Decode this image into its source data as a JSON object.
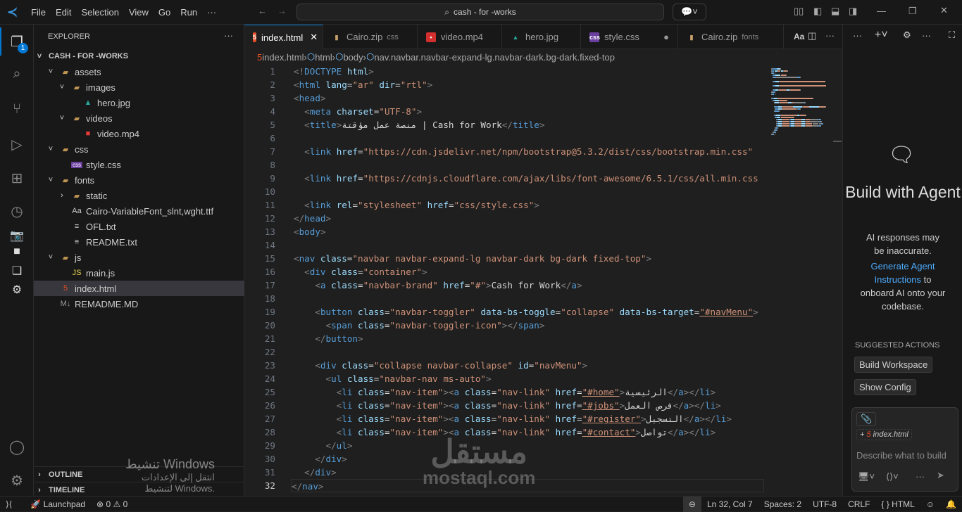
{
  "titlebar": {
    "menu": [
      "File",
      "Edit",
      "Selection",
      "View",
      "Go",
      "Run",
      "···"
    ],
    "search": "cash - for -works"
  },
  "activity": {
    "badge": "1"
  },
  "sidebar": {
    "title": "EXPLORER",
    "more": "···",
    "root": "CASH - FOR -WORKS",
    "items": [
      {
        "label": "assets",
        "level": 1,
        "kind": "folder",
        "open": true
      },
      {
        "label": "images",
        "level": 2,
        "kind": "folder",
        "open": true
      },
      {
        "label": "hero.jpg",
        "level": 3,
        "kind": "image"
      },
      {
        "label": "videos",
        "level": 2,
        "kind": "folder",
        "open": true
      },
      {
        "label": "video.mp4",
        "level": 3,
        "kind": "video"
      },
      {
        "label": "css",
        "level": 1,
        "kind": "folder",
        "open": true
      },
      {
        "label": "style.css",
        "level": 2,
        "kind": "css"
      },
      {
        "label": "fonts",
        "level": 1,
        "kind": "folder",
        "open": true
      },
      {
        "label": "static",
        "level": 2,
        "kind": "folder",
        "open": false
      },
      {
        "label": "Cairo-VariableFont_slnt,wght.ttf",
        "level": 2,
        "kind": "font"
      },
      {
        "label": "OFL.txt",
        "level": 2,
        "kind": "text"
      },
      {
        "label": "README.txt",
        "level": 2,
        "kind": "text"
      },
      {
        "label": "js",
        "level": 1,
        "kind": "folder",
        "open": true
      },
      {
        "label": "main.js",
        "level": 2,
        "kind": "js"
      },
      {
        "label": "index.html",
        "level": 1,
        "kind": "html",
        "selected": true
      },
      {
        "label": "REMADME.MD",
        "level": 1,
        "kind": "md"
      }
    ],
    "outline": "OUTLINE",
    "timeline": "TIMELINE"
  },
  "tabs": [
    {
      "label": "index.html",
      "kind": "html",
      "active": true,
      "close": "✕"
    },
    {
      "label": "Cairo.zip",
      "sub": "css",
      "kind": "zip"
    },
    {
      "label": "video.mp4",
      "kind": "video"
    },
    {
      "label": "hero.jpg",
      "kind": "image"
    },
    {
      "label": "style.css",
      "kind": "css",
      "dirty": "●"
    },
    {
      "label": "Cairo.zip",
      "sub": "fonts",
      "kind": "zip"
    }
  ],
  "breadcrumb": [
    "index.html",
    "html",
    "body",
    "nav.navbar.navbar-expand-lg.navbar-dark.bg-dark.fixed-top"
  ],
  "code": [
    [
      [
        "p",
        "<!"
      ],
      [
        "t",
        "DOCTYPE"
      ],
      [
        "a",
        " html"
      ],
      [
        "p",
        ">"
      ]
    ],
    [
      [
        "p",
        "<"
      ],
      [
        "t",
        "html"
      ],
      [
        "a",
        " lang"
      ],
      [
        "x",
        "="
      ],
      [
        "s",
        "\"ar\""
      ],
      [
        "a",
        " dir"
      ],
      [
        "x",
        "="
      ],
      [
        "s",
        "\"rtl\""
      ],
      [
        "p",
        ">"
      ]
    ],
    [
      [
        "p",
        "<"
      ],
      [
        "t",
        "head"
      ],
      [
        "p",
        ">"
      ]
    ],
    [
      [
        "x",
        "  "
      ],
      [
        "p",
        "<"
      ],
      [
        "t",
        "meta"
      ],
      [
        "a",
        " charset"
      ],
      [
        "x",
        "="
      ],
      [
        "s",
        "\"UTF-8\""
      ],
      [
        "p",
        ">"
      ]
    ],
    [
      [
        "x",
        "  "
      ],
      [
        "p",
        "<"
      ],
      [
        "t",
        "title"
      ],
      [
        "p",
        ">"
      ],
      [
        "x",
        "منصة عمل مؤقتة | Cash for Work"
      ],
      [
        "p",
        "</"
      ],
      [
        "t",
        "title"
      ],
      [
        "p",
        ">"
      ]
    ],
    [],
    [
      [
        "x",
        "  "
      ],
      [
        "p",
        "<"
      ],
      [
        "t",
        "link"
      ],
      [
        "a",
        " href"
      ],
      [
        "x",
        "="
      ],
      [
        "s",
        "\"https://cdn.jsdelivr.net/npm/bootstrap@5.3.2/dist/css/bootstrap.min.css\""
      ]
    ],
    [],
    [
      [
        "x",
        "  "
      ],
      [
        "p",
        "<"
      ],
      [
        "t",
        "link"
      ],
      [
        "a",
        " href"
      ],
      [
        "x",
        "="
      ],
      [
        "s",
        "\"https://cdnjs.cloudflare.com/ajax/libs/font-awesome/6.5.1/css/all.min.css"
      ]
    ],
    [],
    [
      [
        "x",
        "  "
      ],
      [
        "p",
        "<"
      ],
      [
        "t",
        "link"
      ],
      [
        "a",
        " rel"
      ],
      [
        "x",
        "="
      ],
      [
        "s",
        "\"stylesheet\""
      ],
      [
        "a",
        " href"
      ],
      [
        "x",
        "="
      ],
      [
        "s",
        "\"css/style.css\""
      ],
      [
        "p",
        ">"
      ]
    ],
    [
      [
        "p",
        "</"
      ],
      [
        "t",
        "head"
      ],
      [
        "p",
        ">"
      ]
    ],
    [
      [
        "p",
        "<"
      ],
      [
        "t",
        "body"
      ],
      [
        "p",
        ">"
      ]
    ],
    [],
    [
      [
        "p",
        "<"
      ],
      [
        "t",
        "nav"
      ],
      [
        "a",
        " class"
      ],
      [
        "x",
        "="
      ],
      [
        "s",
        "\"navbar navbar-expand-lg navbar-dark bg-dark fixed-top\""
      ],
      [
        "p",
        ">"
      ]
    ],
    [
      [
        "x",
        "  "
      ],
      [
        "p",
        "<"
      ],
      [
        "t",
        "div"
      ],
      [
        "a",
        " class"
      ],
      [
        "x",
        "="
      ],
      [
        "s",
        "\"container\""
      ],
      [
        "p",
        ">"
      ]
    ],
    [
      [
        "x",
        "    "
      ],
      [
        "p",
        "<"
      ],
      [
        "t",
        "a"
      ],
      [
        "a",
        " class"
      ],
      [
        "x",
        "="
      ],
      [
        "s",
        "\"navbar-brand\""
      ],
      [
        "a",
        " href"
      ],
      [
        "x",
        "="
      ],
      [
        "s",
        "\"#\""
      ],
      [
        "p",
        ">"
      ],
      [
        "x",
        "Cash for Work"
      ],
      [
        "p",
        "</"
      ],
      [
        "t",
        "a"
      ],
      [
        "p",
        ">"
      ]
    ],
    [],
    [
      [
        "x",
        "    "
      ],
      [
        "p",
        "<"
      ],
      [
        "t",
        "button"
      ],
      [
        "a",
        " class"
      ],
      [
        "x",
        "="
      ],
      [
        "s",
        "\"navbar-toggler\""
      ],
      [
        "a",
        " data-bs-toggle"
      ],
      [
        "x",
        "="
      ],
      [
        "s",
        "\"collapse\""
      ],
      [
        "a",
        " data-bs-target"
      ],
      [
        "x",
        "="
      ],
      [
        "s",
        "\"#navMenu\""
      ],
      [
        "p",
        ">"
      ]
    ],
    [
      [
        "x",
        "      "
      ],
      [
        "p",
        "<"
      ],
      [
        "t",
        "span"
      ],
      [
        "a",
        " class"
      ],
      [
        "x",
        "="
      ],
      [
        "s",
        "\"navbar-toggler-icon\""
      ],
      [
        "p",
        "></"
      ],
      [
        "t",
        "span"
      ],
      [
        "p",
        ">"
      ]
    ],
    [
      [
        "x",
        "    "
      ],
      [
        "p",
        "</"
      ],
      [
        "t",
        "button"
      ],
      [
        "p",
        ">"
      ]
    ],
    [],
    [
      [
        "x",
        "    "
      ],
      [
        "p",
        "<"
      ],
      [
        "t",
        "div"
      ],
      [
        "a",
        " class"
      ],
      [
        "x",
        "="
      ],
      [
        "s",
        "\"collapse navbar-collapse\""
      ],
      [
        "a",
        " id"
      ],
      [
        "x",
        "="
      ],
      [
        "s",
        "\"navMenu\""
      ],
      [
        "p",
        ">"
      ]
    ],
    [
      [
        "x",
        "      "
      ],
      [
        "p",
        "<"
      ],
      [
        "t",
        "ul"
      ],
      [
        "a",
        " class"
      ],
      [
        "x",
        "="
      ],
      [
        "s",
        "\"navbar-nav ms-auto\""
      ],
      [
        "p",
        ">"
      ]
    ],
    [
      [
        "x",
        "        "
      ],
      [
        "p",
        "<"
      ],
      [
        "t",
        "li"
      ],
      [
        "a",
        " class"
      ],
      [
        "x",
        "="
      ],
      [
        "s",
        "\"nav-item\""
      ],
      [
        "p",
        "><"
      ],
      [
        "t",
        "a"
      ],
      [
        "a",
        " class"
      ],
      [
        "x",
        "="
      ],
      [
        "s",
        "\"nav-link\""
      ],
      [
        "a",
        " href"
      ],
      [
        "x",
        "="
      ],
      [
        "s",
        "\"#home\""
      ],
      [
        "p",
        ">"
      ],
      [
        "x",
        "الرئيسية"
      ],
      [
        "p",
        "</"
      ],
      [
        "t",
        "a"
      ],
      [
        "p",
        "></"
      ],
      [
        "t",
        "li"
      ],
      [
        "p",
        ">"
      ]
    ],
    [
      [
        "x",
        "        "
      ],
      [
        "p",
        "<"
      ],
      [
        "t",
        "li"
      ],
      [
        "a",
        " class"
      ],
      [
        "x",
        "="
      ],
      [
        "s",
        "\"nav-item\""
      ],
      [
        "p",
        "><"
      ],
      [
        "t",
        "a"
      ],
      [
        "a",
        " class"
      ],
      [
        "x",
        "="
      ],
      [
        "s",
        "\"nav-link\""
      ],
      [
        "a",
        " href"
      ],
      [
        "x",
        "="
      ],
      [
        "s",
        "\"#jobs\""
      ],
      [
        "p",
        ">"
      ],
      [
        "x",
        "فرص العمل"
      ],
      [
        "p",
        "</"
      ],
      [
        "t",
        "a"
      ],
      [
        "p",
        "></"
      ],
      [
        "t",
        "li"
      ],
      [
        "p",
        ">"
      ]
    ],
    [
      [
        "x",
        "        "
      ],
      [
        "p",
        "<"
      ],
      [
        "t",
        "li"
      ],
      [
        "a",
        " class"
      ],
      [
        "x",
        "="
      ],
      [
        "s",
        "\"nav-item\""
      ],
      [
        "p",
        "><"
      ],
      [
        "t",
        "a"
      ],
      [
        "a",
        " class"
      ],
      [
        "x",
        "="
      ],
      [
        "s",
        "\"nav-link\""
      ],
      [
        "a",
        " href"
      ],
      [
        "x",
        "="
      ],
      [
        "s",
        "\"#register\""
      ],
      [
        "p",
        ">"
      ],
      [
        "x",
        "التسجيل"
      ],
      [
        "p",
        "</"
      ],
      [
        "t",
        "a"
      ],
      [
        "p",
        "></"
      ],
      [
        "t",
        "li"
      ],
      [
        "p",
        ">"
      ]
    ],
    [
      [
        "x",
        "        "
      ],
      [
        "p",
        "<"
      ],
      [
        "t",
        "li"
      ],
      [
        "a",
        " class"
      ],
      [
        "x",
        "="
      ],
      [
        "s",
        "\"nav-item\""
      ],
      [
        "p",
        "><"
      ],
      [
        "t",
        "a"
      ],
      [
        "a",
        " class"
      ],
      [
        "x",
        "="
      ],
      [
        "s",
        "\"nav-link\""
      ],
      [
        "a",
        " href"
      ],
      [
        "x",
        "="
      ],
      [
        "s",
        "\"#contact\""
      ],
      [
        "p",
        ">"
      ],
      [
        "x",
        "تواصل"
      ],
      [
        "p",
        "</"
      ],
      [
        "t",
        "a"
      ],
      [
        "p",
        "></"
      ],
      [
        "t",
        "li"
      ],
      [
        "p",
        ">"
      ]
    ],
    [
      [
        "x",
        "      "
      ],
      [
        "p",
        "</"
      ],
      [
        "t",
        "ul"
      ],
      [
        "p",
        ">"
      ]
    ],
    [
      [
        "x",
        "    "
      ],
      [
        "p",
        "</"
      ],
      [
        "t",
        "div"
      ],
      [
        "p",
        ">"
      ]
    ],
    [
      [
        "x",
        "  "
      ],
      [
        "p",
        "</"
      ],
      [
        "t",
        "div"
      ],
      [
        "p",
        ">"
      ]
    ],
    [
      [
        "p",
        "</"
      ],
      [
        "t",
        "nav"
      ],
      [
        "p",
        ">"
      ]
    ]
  ],
  "current_line": 32,
  "right_panel": {
    "title": "Build with Agent",
    "disclaimer": "AI responses may be inaccurate.",
    "link": "Generate Agent Instructions",
    "link_tail": "to onboard AI onto your codebase.",
    "suggested": "SUGGESTED ACTIONS",
    "actions": [
      "Build Workspace",
      "Show Config"
    ],
    "context_file": "index.html",
    "placeholder": "Describe what to build"
  },
  "watermark": {
    "arabic": "مستقل",
    "latin": "mostaql.com"
  },
  "windows_activation": {
    "line1": "تنشيط Windows",
    "line2": "انتقل إلى الإعدادات لتنشيط Windows."
  },
  "status": {
    "launchpad": "Launchpad",
    "errors": "0",
    "warnings": "0",
    "position": "Ln 32, Col 7",
    "spaces": "Spaces: 2",
    "encoding": "UTF-8",
    "eol": "CRLF",
    "language": "HTML"
  }
}
